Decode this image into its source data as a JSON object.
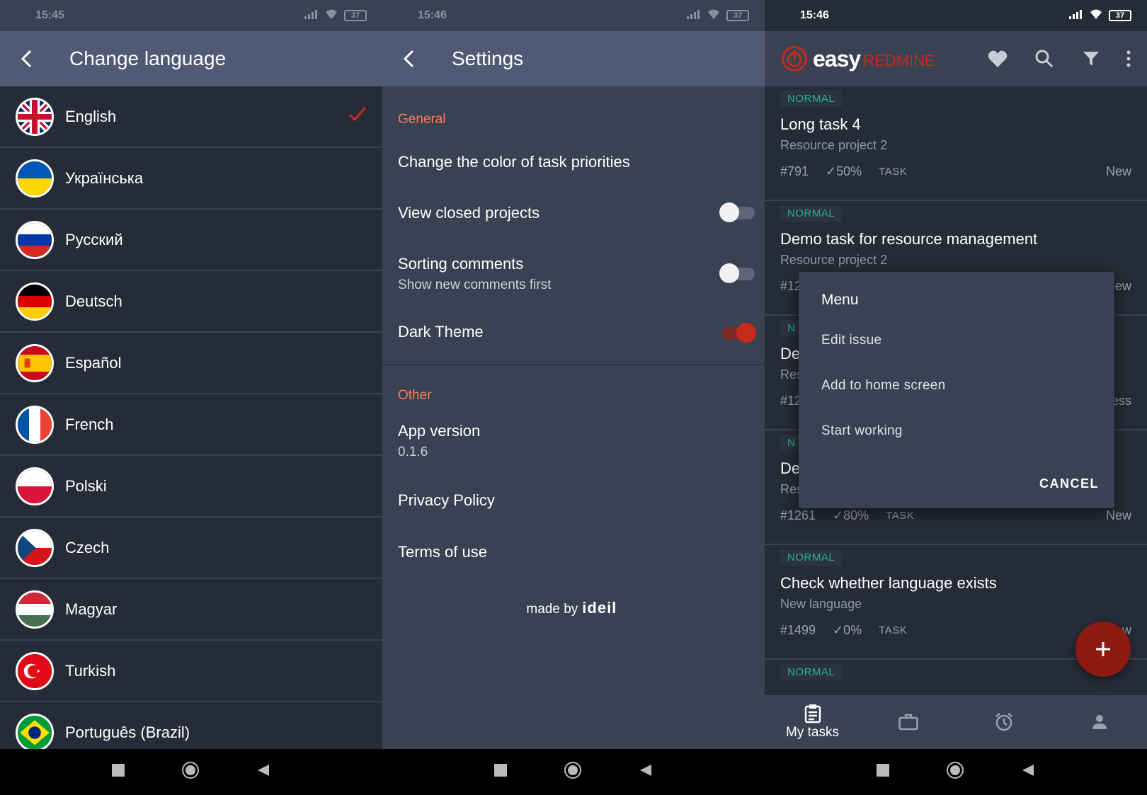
{
  "screen1": {
    "status_time": "15:45",
    "battery": "37",
    "title": "Change language",
    "languages": [
      {
        "label": "English",
        "flag": "uk",
        "selected": true
      },
      {
        "label": "Українська",
        "flag": "ua"
      },
      {
        "label": "Русский",
        "flag": "ru"
      },
      {
        "label": "Deutsch",
        "flag": "de"
      },
      {
        "label": "Español",
        "flag": "es"
      },
      {
        "label": "French",
        "flag": "fr"
      },
      {
        "label": "Polski",
        "flag": "pl"
      },
      {
        "label": "Czech",
        "flag": "cz"
      },
      {
        "label": "Magyar",
        "flag": "hu"
      },
      {
        "label": "Turkish",
        "flag": "tr"
      },
      {
        "label": "Português (Brazil)",
        "flag": "br"
      }
    ]
  },
  "screen2": {
    "status_time": "15:46",
    "battery": "37",
    "title": "Settings",
    "general_header": "General",
    "change_color": "Change the color of task priorities",
    "view_closed": "View closed projects",
    "view_closed_on": false,
    "sorting": "Sorting comments",
    "sorting_sub": "Show new comments first",
    "sorting_on": false,
    "dark_theme": "Dark Theme",
    "dark_theme_on": true,
    "other_header": "Other",
    "app_version_label": "App version",
    "app_version": "0.1.6",
    "privacy": "Privacy Policy",
    "terms": "Terms of use",
    "made_by": "made by",
    "made_by_brand": "ideil"
  },
  "screen3": {
    "status_time": "15:46",
    "battery": "37",
    "logo_easy": "easy",
    "logo_redmine": "REDMINE",
    "tasks": [
      {
        "priority": "NORMAL",
        "title": "Long task 4",
        "project": "Resource project 2",
        "number": "#791",
        "done": "50%",
        "type": "TASK",
        "status": "New"
      },
      {
        "priority": "NORMAL",
        "title": "Demo task for resource management",
        "project": "Resource project 2",
        "number": "#12",
        "done": "",
        "type": "",
        "status": "ew"
      },
      {
        "priority": "N",
        "title": "De",
        "project": "Res",
        "number": "#12",
        "done": "",
        "type": "",
        "status": "ess"
      },
      {
        "priority": "N",
        "title": "De",
        "project": "Res",
        "number": "#1261",
        "done": "80%",
        "type": "TASK",
        "status": "New"
      },
      {
        "priority": "NORMAL",
        "title": "Check whether language exists",
        "project": "New language",
        "number": "#1499",
        "done": "0%",
        "type": "TASK",
        "status": "w"
      },
      {
        "priority": "NORMAL",
        "title": "",
        "project": "",
        "number": "",
        "done": "",
        "type": "",
        "status": ""
      }
    ],
    "menu": {
      "title": "Menu",
      "items": [
        "Edit issue",
        "Add to home screen",
        "Start working"
      ],
      "cancel": "CANCEL"
    },
    "bottom_nav": {
      "my_tasks": "My tasks"
    }
  },
  "colors": {
    "accent": "#c52a1a",
    "section_header": "#ff7a55",
    "priority_normal": "#27b08a"
  }
}
